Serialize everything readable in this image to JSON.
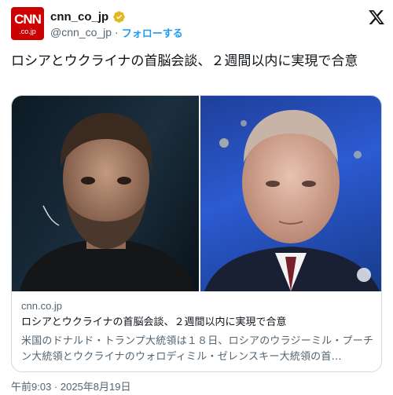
{
  "account": {
    "avatar_text": "CNN",
    "avatar_subtext": ".co.jp",
    "name": "cnn_co_jp",
    "handle": "@cnn_co_jp",
    "separator": "·",
    "follow_label": "フォローする"
  },
  "tweet": {
    "text": "ロシアとウクライナの首脳会談、２週間以内に実現で合意"
  },
  "card": {
    "domain": "cnn.co.jp",
    "title": "ロシアとウクライナの首脳会談、２週間以内に実現で合意",
    "description": "米国のドナルド・トランプ大統領は１８日、ロシアのウラジーミル・プーチン大統領とウクライナのウォロディミル・ゼレンスキー大統領の首…"
  },
  "timestamp": "午前9:03 · 2025年8月19日",
  "colors": {
    "brand_red": "#cc0000",
    "link_blue": "#1d9bf0",
    "verified_gold": "#e2b719",
    "muted_text": "#536471"
  },
  "icons": {
    "verified": "verified-badge-icon",
    "platform": "x-logo-icon"
  }
}
